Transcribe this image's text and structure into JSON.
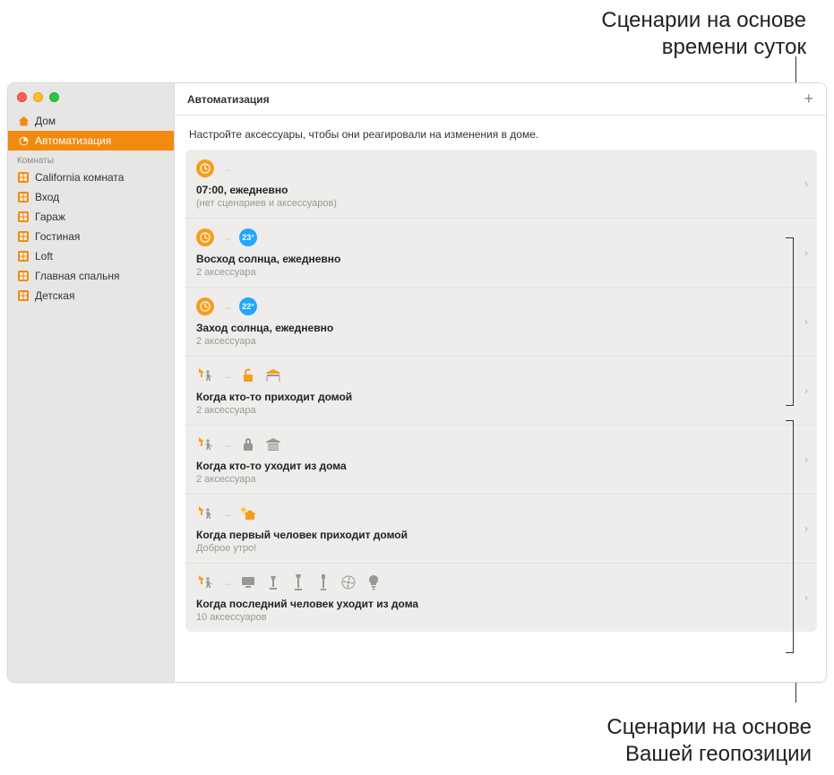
{
  "annotations": {
    "top": "Сценарии на основе\nвремени суток",
    "bottom": "Сценарии на основе\nВашей геопозиции"
  },
  "header": {
    "title": "Автоматизация"
  },
  "subtitle": "Настройте аксессуары, чтобы они реагировали на изменения в доме.",
  "sidebar": {
    "items": [
      {
        "label": "Дом",
        "selected": false,
        "icon": "house"
      },
      {
        "label": "Автоматизация",
        "selected": true,
        "icon": "chat"
      }
    ],
    "section_label": "Комнаты",
    "rooms": [
      {
        "label": "California комната"
      },
      {
        "label": "Вход"
      },
      {
        "label": "Гараж"
      },
      {
        "label": "Гостиная"
      },
      {
        "label": "Loft"
      },
      {
        "label": "Главная спальня"
      },
      {
        "label": "Детская"
      }
    ]
  },
  "automations": [
    {
      "title": "07:00, ежедневно",
      "subtitle": "(нет сценариев и аксессуаров)",
      "trigger_icon": "clock",
      "accessory_icons": []
    },
    {
      "title": "Восход солнца, ежедневно",
      "subtitle": "2 аксессуара",
      "trigger_icon": "clock",
      "accessory_icons": [
        {
          "type": "temp",
          "value": "23°"
        }
      ]
    },
    {
      "title": "Заход солнца, ежедневно",
      "subtitle": "2 аксессуара",
      "trigger_icon": "clock",
      "accessory_icons": [
        {
          "type": "temp",
          "value": "22°"
        }
      ]
    },
    {
      "title": "Когда кто-то приходит домой",
      "subtitle": "2 аксессуара",
      "trigger_icon": "person-arrive",
      "accessory_icons": [
        {
          "type": "lock-open"
        },
        {
          "type": "garage-open"
        }
      ]
    },
    {
      "title": "Когда кто-то уходит из дома",
      "subtitle": "2 аксессуара",
      "trigger_icon": "person-leave",
      "accessory_icons": [
        {
          "type": "lock-closed"
        },
        {
          "type": "garage-closed"
        }
      ]
    },
    {
      "title": "Когда первый человек приходит домой",
      "subtitle": "Доброе утро!",
      "trigger_icon": "person-arrive",
      "accessory_icons": [
        {
          "type": "sun-house"
        }
      ]
    },
    {
      "title": "Когда последний человек уходит из дома",
      "subtitle": "10 аксессуаров",
      "trigger_icon": "person-leave",
      "accessory_icons": [
        {
          "type": "screen"
        },
        {
          "type": "lamp-desk"
        },
        {
          "type": "lamp-floor"
        },
        {
          "type": "lamp-floor2"
        },
        {
          "type": "fan"
        },
        {
          "type": "bulb"
        }
      ]
    }
  ]
}
